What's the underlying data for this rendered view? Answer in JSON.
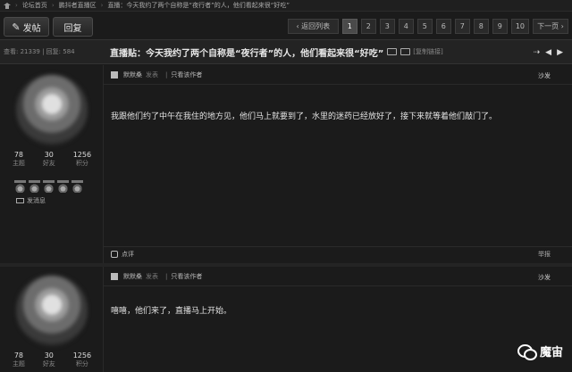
{
  "breadcrumb": {
    "items": [
      "论坛首页",
      "鹏抖者直播区",
      "直播：今天我约了两个自称是“夜行者”的人，他们看起来很“好吃”"
    ]
  },
  "toolbar": {
    "post_label": "发帖",
    "reply_label": "回复"
  },
  "pager": {
    "back_label": "‹ 返回列表",
    "pages": [
      "1",
      "2",
      "3",
      "4",
      "5",
      "6",
      "7",
      "8",
      "9",
      "10"
    ],
    "current": "1",
    "next_label": "下一页 ›"
  },
  "thread": {
    "stats": "查看: 21339 | 回复: 584",
    "title": "直播贴：今天我约了两个自称是“夜行者”的人，他们看起来很“好吃”",
    "copy_link": "[复制链接]"
  },
  "posts": [
    {
      "author": "默默桑",
      "posted": "发表",
      "only_author": "只看该作者",
      "floor": "沙发",
      "content": "我跟他们约了中午在我住的地方见，他们马上就要到了，水里的迷药已经放好了，接下来就等着他们敲门了。",
      "rate_label": "点评",
      "report_label": "举报",
      "user": {
        "topics": "78",
        "topics_label": "主题",
        "friends": "30",
        "friends_label": "好友",
        "points": "1256",
        "points_label": "积分",
        "send_msg": "发消息"
      }
    },
    {
      "author": "默默桑",
      "posted": "发表",
      "only_author": "只看该作者",
      "floor": "沙发",
      "content": "嘻嘻，他们来了，直播马上开始。",
      "user": {
        "topics": "78",
        "topics_label": "主题",
        "friends": "30",
        "friends_label": "好友",
        "points": "1256",
        "points_label": "积分"
      }
    }
  ],
  "watermark": {
    "text": "魔宙"
  }
}
